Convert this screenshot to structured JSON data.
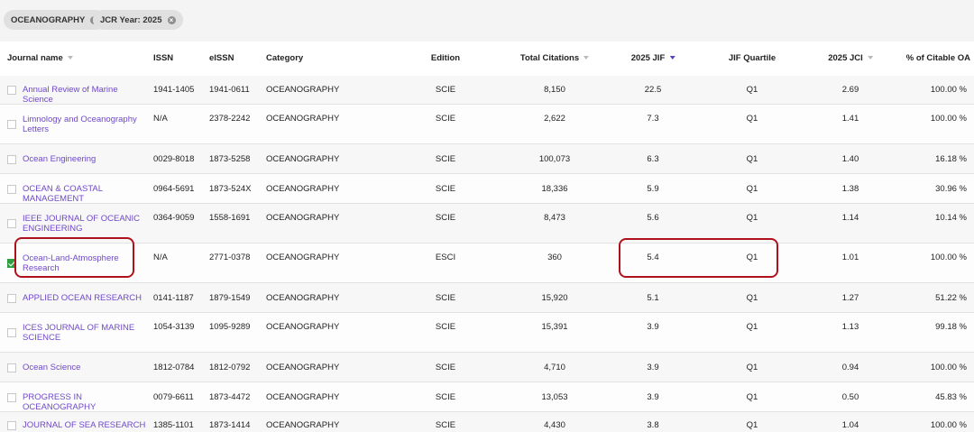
{
  "filters": [
    {
      "label": "OCEANOGRAPHY"
    },
    {
      "label": "JCR Year: 2025"
    }
  ],
  "columns": {
    "journal": "Journal name",
    "issn": "ISSN",
    "eissn": "eISSN",
    "category": "Category",
    "edition": "Edition",
    "citations": "Total Citations",
    "jif": "2025 JIF",
    "quartile": "JIF Quartile",
    "jci": "2025 JCI",
    "oa": "% of Citable OA"
  },
  "rows": [
    {
      "name": "Annual Review of Marine Science",
      "issn": "1941-1405",
      "eissn": "1941-0611",
      "category": "OCEANOGRAPHY",
      "edition": "SCIE",
      "citations": "8,150",
      "jif": "22.5",
      "quartile": "Q1",
      "jci": "2.69",
      "oa": "100.00 %",
      "checked": false
    },
    {
      "name": "Limnology and Oceanography Letters",
      "issn": "N/A",
      "eissn": "2378-2242",
      "category": "OCEANOGRAPHY",
      "edition": "SCIE",
      "citations": "2,622",
      "jif": "7.3",
      "quartile": "Q1",
      "jci": "1.41",
      "oa": "100.00 %",
      "checked": false
    },
    {
      "name": "Ocean Engineering",
      "issn": "0029-8018",
      "eissn": "1873-5258",
      "category": "OCEANOGRAPHY",
      "edition": "SCIE",
      "citations": "100,073",
      "jif": "6.3",
      "quartile": "Q1",
      "jci": "1.40",
      "oa": "16.18 %",
      "checked": false
    },
    {
      "name": "OCEAN & COASTAL MANAGEMENT",
      "issn": "0964-5691",
      "eissn": "1873-524X",
      "category": "OCEANOGRAPHY",
      "edition": "SCIE",
      "citations": "18,336",
      "jif": "5.9",
      "quartile": "Q1",
      "jci": "1.38",
      "oa": "30.96 %",
      "checked": false
    },
    {
      "name": "IEEE JOURNAL OF OCEANIC ENGINEERING",
      "issn": "0364-9059",
      "eissn": "1558-1691",
      "category": "OCEANOGRAPHY",
      "edition": "SCIE",
      "citations": "8,473",
      "jif": "5.6",
      "quartile": "Q1",
      "jci": "1.14",
      "oa": "10.14 %",
      "checked": false
    },
    {
      "name": "Ocean-Land-Atmosphere Research",
      "issn": "N/A",
      "eissn": "2771-0378",
      "category": "OCEANOGRAPHY",
      "edition": "ESCI",
      "citations": "360",
      "jif": "5.4",
      "quartile": "Q1",
      "jci": "1.01",
      "oa": "100.00 %",
      "checked": true
    },
    {
      "name": "APPLIED OCEAN RESEARCH",
      "issn": "0141-1187",
      "eissn": "1879-1549",
      "category": "OCEANOGRAPHY",
      "edition": "SCIE",
      "citations": "15,920",
      "jif": "5.1",
      "quartile": "Q1",
      "jci": "1.27",
      "oa": "51.22 %",
      "checked": false
    },
    {
      "name": "ICES JOURNAL OF MARINE SCIENCE",
      "issn": "1054-3139",
      "eissn": "1095-9289",
      "category": "OCEANOGRAPHY",
      "edition": "SCIE",
      "citations": "15,391",
      "jif": "3.9",
      "quartile": "Q1",
      "jci": "1.13",
      "oa": "99.18 %",
      "checked": false
    },
    {
      "name": "Ocean Science",
      "issn": "1812-0784",
      "eissn": "1812-0792",
      "category": "OCEANOGRAPHY",
      "edition": "SCIE",
      "citations": "4,710",
      "jif": "3.9",
      "quartile": "Q1",
      "jci": "0.94",
      "oa": "100.00 %",
      "checked": false
    },
    {
      "name": "PROGRESS IN OCEANOGRAPHY",
      "issn": "0079-6611",
      "eissn": "1873-4472",
      "category": "OCEANOGRAPHY",
      "edition": "SCIE",
      "citations": "13,053",
      "jif": "3.9",
      "quartile": "Q1",
      "jci": "0.50",
      "oa": "45.83 %",
      "checked": false
    },
    {
      "name": "JOURNAL OF SEA RESEARCH",
      "issn": "1385-1101",
      "eissn": "1873-1414",
      "category": "OCEANOGRAPHY",
      "edition": "SCIE",
      "citations": "4,430",
      "jif": "3.8",
      "quartile": "Q1",
      "jci": "1.04",
      "oa": "100.00 %",
      "checked": false
    }
  ],
  "colors": {
    "link": "#6f49c8",
    "highlight": "#b0121d",
    "check": "#2ea043"
  }
}
